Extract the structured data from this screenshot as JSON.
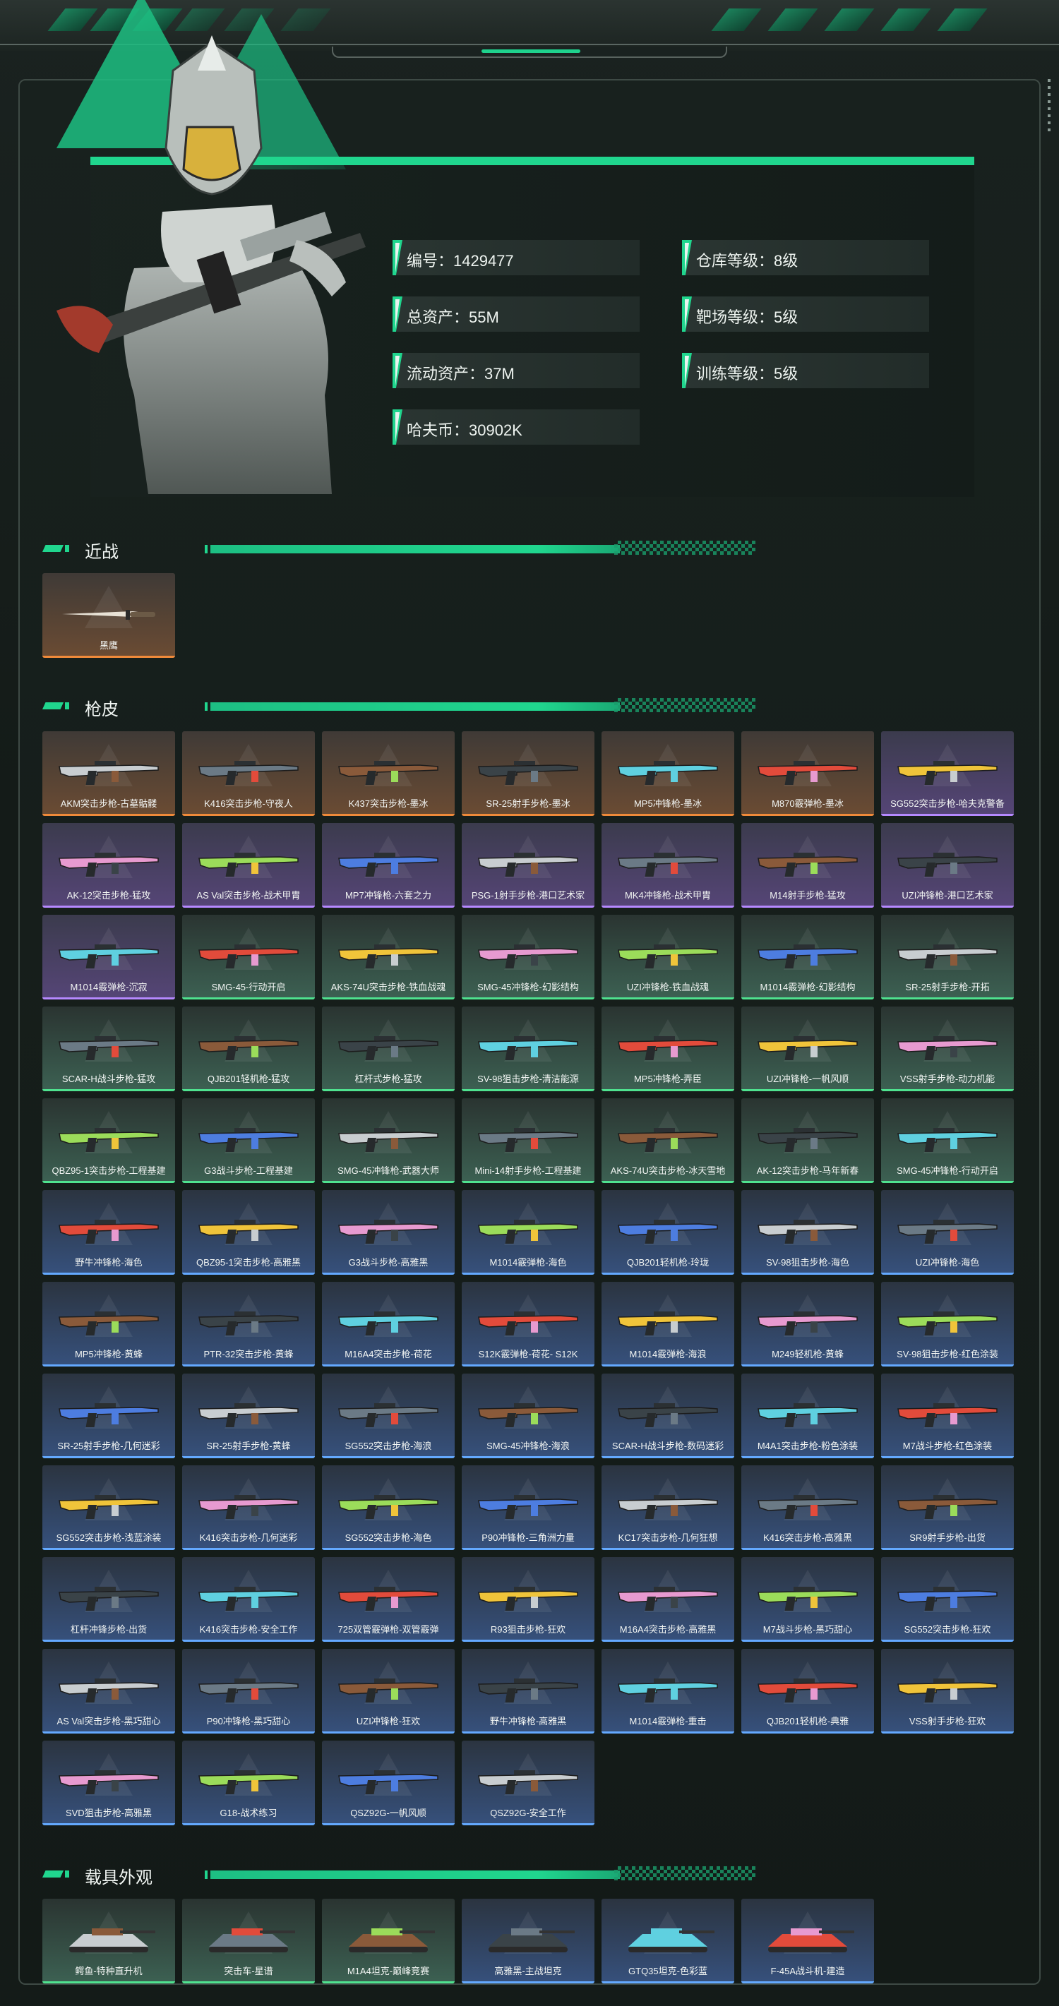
{
  "stats": [
    {
      "label": "编号：1429477"
    },
    {
      "label": "仓库等级：8级"
    },
    {
      "label": "总资产：55M"
    },
    {
      "label": "靶场等级：5级"
    },
    {
      "label": "流动资产：37M"
    },
    {
      "label": "训练等级：5级"
    },
    {
      "label": "哈夫币：30902K"
    }
  ],
  "sections": {
    "melee": {
      "title": "近战",
      "items": [
        {
          "name": "黑鹰",
          "rarity": "orange"
        }
      ]
    },
    "skins": {
      "title": "枪皮",
      "items": [
        {
          "name": "AKM突击步枪-古墓骷髅",
          "rarity": "orange"
        },
        {
          "name": "K416突击步枪-守夜人",
          "rarity": "orange"
        },
        {
          "name": "K437突击步枪-墨冰",
          "rarity": "orange"
        },
        {
          "name": "SR-25射手步枪-墨冰",
          "rarity": "orange"
        },
        {
          "name": "MP5冲锋枪-墨冰",
          "rarity": "orange"
        },
        {
          "name": "M870霰弹枪-墨冰",
          "rarity": "orange"
        },
        {
          "name": "SG552突击步枪-哈夫克警备",
          "rarity": "purple"
        },
        {
          "name": "AK-12突击步枪-猛攻",
          "rarity": "purple"
        },
        {
          "name": "AS Val突击步枪-战术甲胄",
          "rarity": "purple"
        },
        {
          "name": "MP7冲锋枪-六套之力",
          "rarity": "purple"
        },
        {
          "name": "PSG-1射手步枪-港口艺术家",
          "rarity": "purple"
        },
        {
          "name": "MK4冲锋枪-战术甲胄",
          "rarity": "purple"
        },
        {
          "name": "M14射手步枪-猛攻",
          "rarity": "purple"
        },
        {
          "name": "UZI冲锋枪-港口艺术家",
          "rarity": "purple"
        },
        {
          "name": "M1014霰弹枪-沉寂",
          "rarity": "purple"
        },
        {
          "name": "SMG-45-行动开启",
          "rarity": "green"
        },
        {
          "name": "AKS-74U突击步枪-铁血战魂",
          "rarity": "green"
        },
        {
          "name": "SMG-45冲锋枪-幻影结构",
          "rarity": "green"
        },
        {
          "name": "UZI冲锋枪-铁血战魂",
          "rarity": "green"
        },
        {
          "name": "M1014霰弹枪-幻影结构",
          "rarity": "green"
        },
        {
          "name": "SR-25射手步枪-开拓",
          "rarity": "green"
        },
        {
          "name": "SCAR-H战斗步枪-猛攻",
          "rarity": "green"
        },
        {
          "name": "QJB201轻机枪-猛攻",
          "rarity": "green"
        },
        {
          "name": "杠杆式步枪-猛攻",
          "rarity": "green"
        },
        {
          "name": "SV-98狙击步枪-清洁能源",
          "rarity": "green"
        },
        {
          "name": "MP5冲锋枪-弄臣",
          "rarity": "green"
        },
        {
          "name": "UZI冲锋枪-一帆风顺",
          "rarity": "green"
        },
        {
          "name": "VSS射手步枪-动力机能",
          "rarity": "green"
        },
        {
          "name": "QBZ95-1突击步枪-工程基建",
          "rarity": "green"
        },
        {
          "name": "G3战斗步枪-工程基建",
          "rarity": "green"
        },
        {
          "name": "SMG-45冲锋枪-武器大师",
          "rarity": "green"
        },
        {
          "name": "Mini-14射手步枪-工程基建",
          "rarity": "green"
        },
        {
          "name": "AKS-74U突击步枪-冰天雪地",
          "rarity": "green"
        },
        {
          "name": "AK-12突击步枪-马年新春",
          "rarity": "green"
        },
        {
          "name": "SMG-45冲锋枪-行动开启",
          "rarity": "green"
        },
        {
          "name": "野牛冲锋枪-海色",
          "rarity": "blue"
        },
        {
          "name": "QBZ95-1突击步枪-高雅黑",
          "rarity": "blue"
        },
        {
          "name": "G3战斗步枪-高雅黑",
          "rarity": "blue"
        },
        {
          "name": "M1014霰弹枪-海色",
          "rarity": "blue"
        },
        {
          "name": "QJB201轻机枪-玲珑",
          "rarity": "blue"
        },
        {
          "name": "SV-98狙击步枪-海色",
          "rarity": "blue"
        },
        {
          "name": "UZI冲锋枪-海色",
          "rarity": "blue"
        },
        {
          "name": "MP5冲锋枪-黄蜂",
          "rarity": "blue"
        },
        {
          "name": "PTR-32突击步枪-黄蜂",
          "rarity": "blue"
        },
        {
          "name": "M16A4突击步枪-荷花",
          "rarity": "blue"
        },
        {
          "name": "S12K霰弹枪-荷花- S12K",
          "rarity": "blue"
        },
        {
          "name": "M1014霰弹枪-海浪",
          "rarity": "blue"
        },
        {
          "name": "M249轻机枪-黄蜂",
          "rarity": "blue"
        },
        {
          "name": "SV-98狙击步枪-红色涂装",
          "rarity": "blue"
        },
        {
          "name": "SR-25射手步枪-几何迷彩",
          "rarity": "blue"
        },
        {
          "name": "SR-25射手步枪-黄蜂",
          "rarity": "blue"
        },
        {
          "name": "SG552突击步枪-海浪",
          "rarity": "blue"
        },
        {
          "name": "SMG-45冲锋枪-海浪",
          "rarity": "blue"
        },
        {
          "name": "SCAR-H战斗步枪-数码迷彩",
          "rarity": "blue"
        },
        {
          "name": "M4A1突击步枪-粉色涂装",
          "rarity": "blue"
        },
        {
          "name": "M7战斗步枪-红色涂装",
          "rarity": "blue"
        },
        {
          "name": "SG552突击步枪-浅蓝涂装",
          "rarity": "blue"
        },
        {
          "name": "K416突击步枪-几何迷彩",
          "rarity": "blue"
        },
        {
          "name": "SG552突击步枪-海色",
          "rarity": "blue"
        },
        {
          "name": "P90冲锋枪-三角洲力量",
          "rarity": "blue"
        },
        {
          "name": "KC17突击步枪-几何狂想",
          "rarity": "blue"
        },
        {
          "name": "K416突击步枪-高雅黑",
          "rarity": "blue"
        },
        {
          "name": "SR9射手步枪-出货",
          "rarity": "blue"
        },
        {
          "name": "杠杆冲锋步枪-出货",
          "rarity": "blue"
        },
        {
          "name": "K416突击步枪-安全工作",
          "rarity": "blue"
        },
        {
          "name": "725双管霰弹枪-双管霰弹",
          "rarity": "blue"
        },
        {
          "name": "R93狙击步枪-狂欢",
          "rarity": "blue"
        },
        {
          "name": "M16A4突击步枪-高雅黑",
          "rarity": "blue"
        },
        {
          "name": "M7战斗步枪-黑巧甜心",
          "rarity": "blue"
        },
        {
          "name": "SG552突击步枪-狂欢",
          "rarity": "blue"
        },
        {
          "name": "AS Val突击步枪-黑巧甜心",
          "rarity": "blue"
        },
        {
          "name": "P90冲锋枪-黑巧甜心",
          "rarity": "blue"
        },
        {
          "name": "UZI冲锋枪-狂欢",
          "rarity": "blue"
        },
        {
          "name": "野牛冲锋枪-高雅黑",
          "rarity": "blue"
        },
        {
          "name": "M1014霰弹枪-重击",
          "rarity": "blue"
        },
        {
          "name": "QJB201轻机枪-典雅",
          "rarity": "blue"
        },
        {
          "name": "VSS射手步枪-狂欢",
          "rarity": "blue"
        },
        {
          "name": "SVD狙击步枪-高雅黑",
          "rarity": "blue"
        },
        {
          "name": "G18-战术练习",
          "rarity": "blue"
        },
        {
          "name": "QSZ92G-一帆风顺",
          "rarity": "blue"
        },
        {
          "name": "QSZ92G-安全工作",
          "rarity": "blue"
        }
      ]
    },
    "vehicles": {
      "title": "载具外观",
      "items": [
        {
          "name": "鳄鱼-特种直升机",
          "rarity": "green"
        },
        {
          "name": "突击车-星谱",
          "rarity": "green"
        },
        {
          "name": "M1A4坦克-巅峰竞赛",
          "rarity": "green"
        },
        {
          "name": "高雅黑-主战坦克",
          "rarity": "blue"
        },
        {
          "name": "GTQ35坦克-色彩蓝",
          "rarity": "blue"
        },
        {
          "name": "F-45A战斗机-建造",
          "rarity": "blue"
        }
      ]
    }
  },
  "colors": {
    "accent": "#20d68e",
    "orange": "#f08a3a",
    "purple": "#b689ff",
    "green": "#4fe28f",
    "blue": "#64a9ff"
  }
}
